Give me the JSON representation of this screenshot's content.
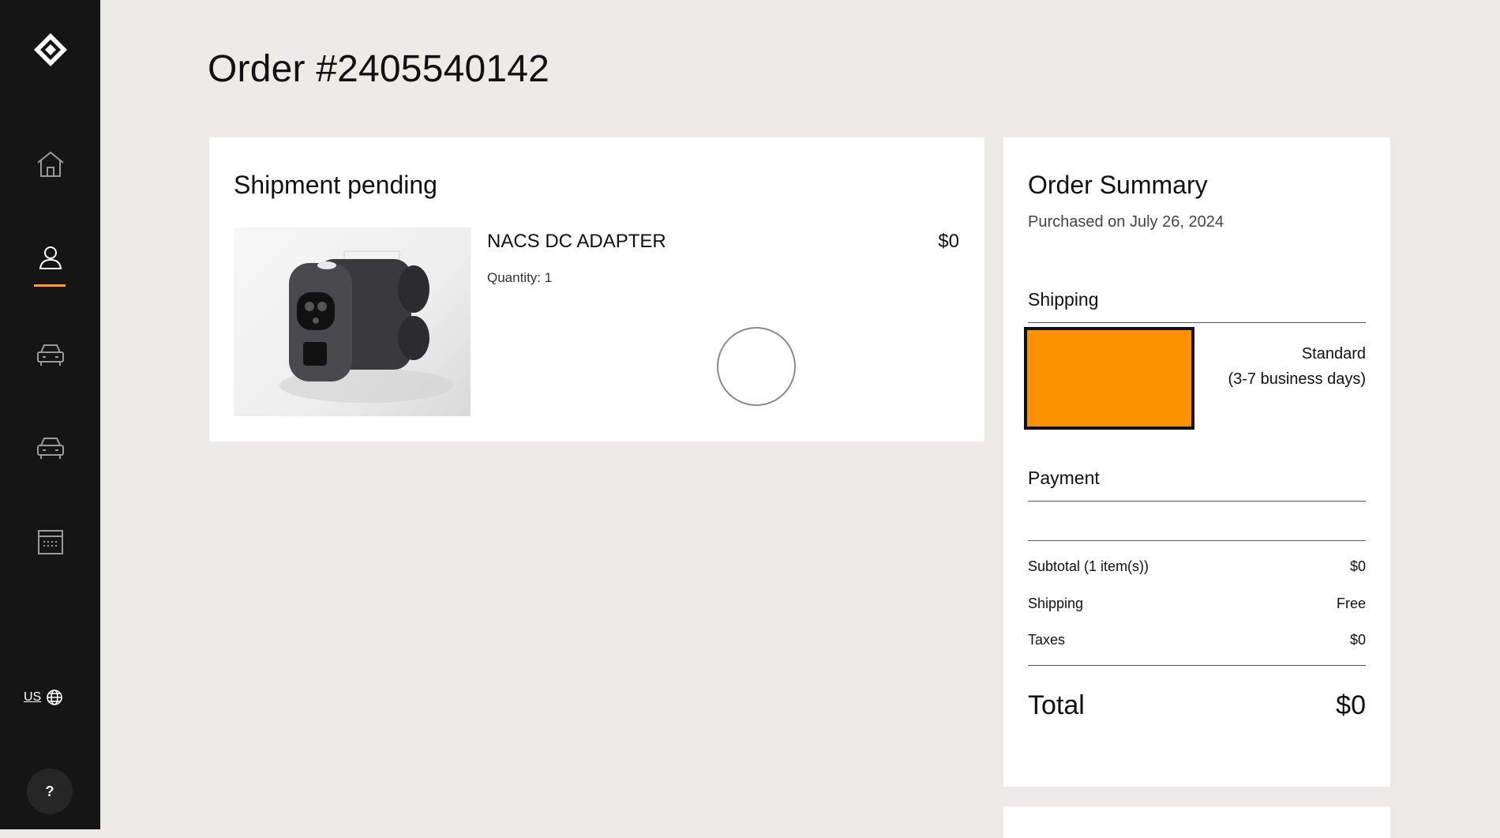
{
  "sidebar": {
    "items": [
      {
        "icon": "home-icon"
      },
      {
        "icon": "person-icon",
        "active": true
      },
      {
        "icon": "car-icon"
      },
      {
        "icon": "car-icon"
      },
      {
        "icon": "calendar-icon"
      }
    ],
    "region_label": "US",
    "help_label": "?",
    "active_color": "#f5a04a"
  },
  "page": {
    "title": "Order #2405540142"
  },
  "shipment": {
    "title": "Shipment pending",
    "product": {
      "name": "NACS DC ADAPTER",
      "price": "$0",
      "quantity": "Quantity: 1"
    }
  },
  "summary": {
    "title": "Order Summary",
    "purchased": "Purchased on July 26, 2024",
    "shipping_label": "Shipping",
    "shipping_method": "Standard",
    "shipping_time": "(3-7 business days)",
    "shipping_box_color": "#fd9200",
    "payment_label": "Payment",
    "lines": [
      {
        "label": "Subtotal (1 item(s))",
        "value": "$0"
      },
      {
        "label": "Shipping",
        "value": "Free"
      },
      {
        "label": "Taxes",
        "value": "$0"
      }
    ],
    "total_label": "Total",
    "total_value": "$0"
  }
}
